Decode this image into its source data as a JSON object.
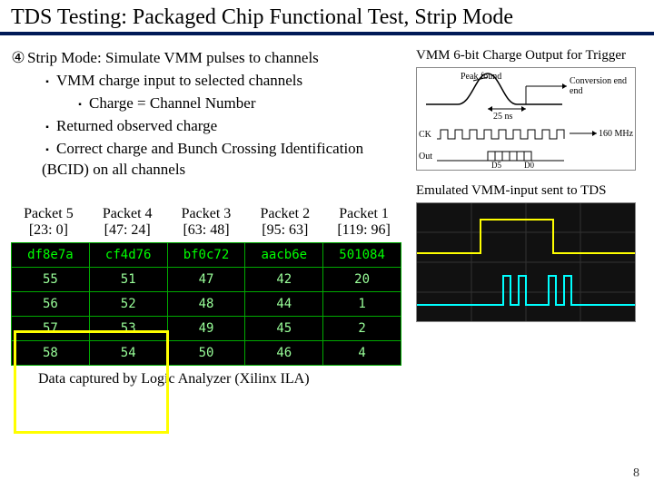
{
  "title": "TDS Testing: Packaged Chip Functional Test, Strip Mode",
  "bullets": {
    "top": "Strip Mode: Simulate VMM pulses to channels",
    "sub1": "VMM charge input to selected channels",
    "subsub1": "Charge = Channel Number",
    "sub2": "Returned observed charge",
    "sub3": "Correct charge and Bunch Crossing Identification (BCID) on all channels"
  },
  "packet_labels": [
    {
      "name": "Packet 5",
      "range": "[23: 0]"
    },
    {
      "name": "Packet 4",
      "range": "[47: 24]"
    },
    {
      "name": "Packet 3",
      "range": "[63: 48]"
    },
    {
      "name": "Packet 2",
      "range": "[95: 63]"
    },
    {
      "name": "Packet 1",
      "range": "[119: 96]"
    }
  ],
  "ila_table": [
    [
      "df8e7a",
      "cf4d76",
      "bf0c72",
      "aacb6e",
      "501084"
    ],
    [
      "55",
      "51",
      "47",
      "42",
      "20"
    ],
    [
      "56",
      "52",
      "48",
      "44",
      "1"
    ],
    [
      "57",
      "53",
      "49",
      "45",
      "2"
    ],
    [
      "58",
      "54",
      "50",
      "46",
      "4"
    ]
  ],
  "caption": "Data captured by Logic Analyzer (Xilinx ILA)",
  "right": {
    "chart1_title": "VMM 6-bit Charge Output for Trigger",
    "chart1_peak": "Peak found",
    "chart1_25ns": "25 ns",
    "chart1_conv": "Conversion end",
    "chart1_ck": "CK",
    "chart1_out": "Out",
    "chart1_160": "160 MHz",
    "chart1_d5": "D5",
    "chart1_d0": "D0",
    "chart2_title": "Emulated VMM-input sent to TDS"
  },
  "page_number": "8",
  "chart_data": {
    "type": "table",
    "title": "ILA captured packet fields",
    "columns": [
      "Packet 5 [23:0]",
      "Packet 4 [47:24]",
      "Packet 3 [63:48]",
      "Packet 2 [95:63]",
      "Packet 1 [119:96]"
    ],
    "rows": [
      [
        "df8e7a",
        "cf4d76",
        "bf0c72",
        "aacb6e",
        "501084"
      ],
      [
        55,
        51,
        47,
        42,
        20
      ],
      [
        56,
        52,
        48,
        44,
        1
      ],
      [
        57,
        53,
        49,
        45,
        2
      ],
      [
        58,
        54,
        50,
        46,
        4
      ]
    ]
  }
}
